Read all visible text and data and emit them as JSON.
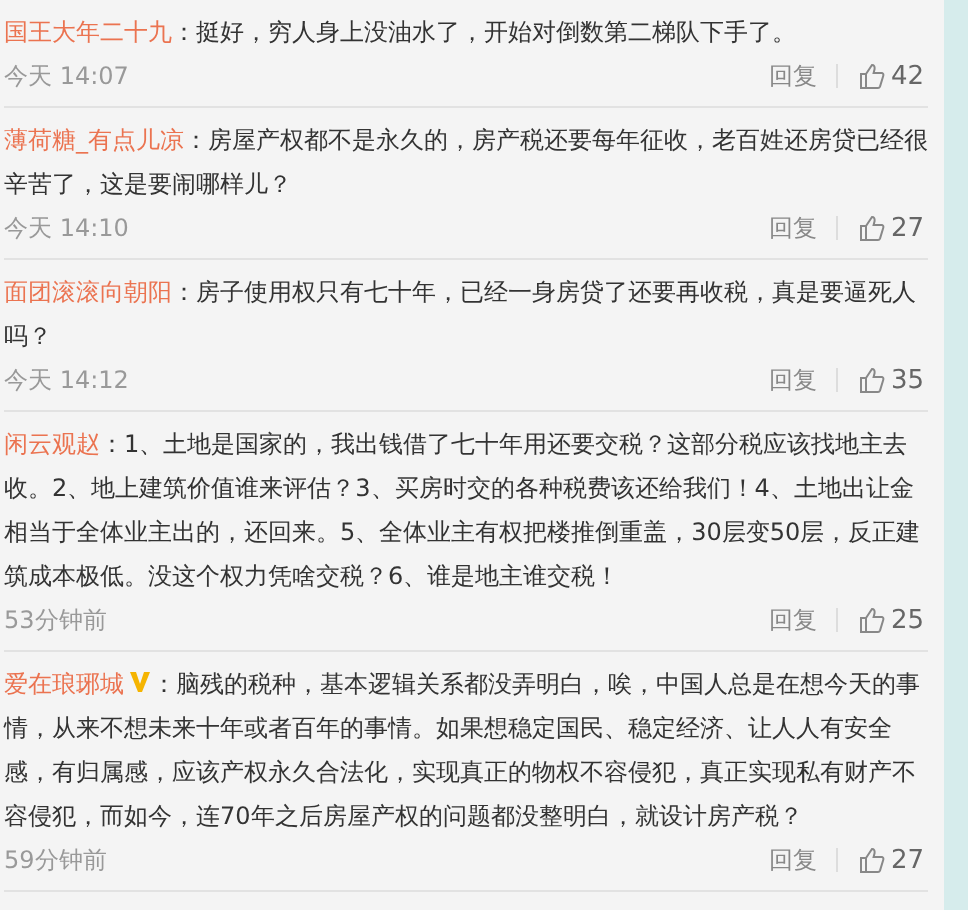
{
  "comments": [
    {
      "user": "国王大年二十九",
      "verified": false,
      "text": "：挺好，穷人身上没油水了，开始对倒数第二梯队下手了。",
      "time": "今天 14:07",
      "reply": "回复",
      "likes": "42"
    },
    {
      "user": "薄荷糖_有点儿凉",
      "verified": false,
      "text": "：房屋产权都不是永久的，房产税还要每年征收，老百姓还房贷已经很辛苦了，这是要闹哪样儿？",
      "time": "今天 14:10",
      "reply": "回复",
      "likes": "27"
    },
    {
      "user": "面团滚滚向朝阳",
      "verified": false,
      "text": "：房子使用权只有七十年，已经一身房贷了还要再收税，真是要逼死人吗？",
      "time": "今天 14:12",
      "reply": "回复",
      "likes": "35"
    },
    {
      "user": "闲云观赵",
      "verified": false,
      "text": "：1、土地是国家的，我出钱借了七十年用还要交税？这部分税应该找地主去收。2、地上建筑价值谁来评估？3、买房时交的各种税费该还给我们！4、土地出让金相当于全体业主出的，还回来。5、全体业主有权把楼推倒重盖，30层变50层，反正建筑成本极低。没这个权力凭啥交税？6、谁是地主谁交税！",
      "time": "53分钟前",
      "reply": "回复",
      "likes": "25"
    },
    {
      "user": "爱在琅琊城",
      "verified": true,
      "text": "：脑残的税种，基本逻辑关系都没弄明白，唉，中国人总是在想今天的事情，从来不想未来十年或者百年的事情。如果想稳定国民、稳定经济、让人人有安全感，有归属感，应该产权永久合法化，实现真正的物权不容侵犯，真正实现私有财产不容侵犯，而如今，连70年之后房屋产权的问题都没整明白，就设计房产税？",
      "time": "59分钟前",
      "reply": "回复",
      "likes": "27"
    }
  ]
}
